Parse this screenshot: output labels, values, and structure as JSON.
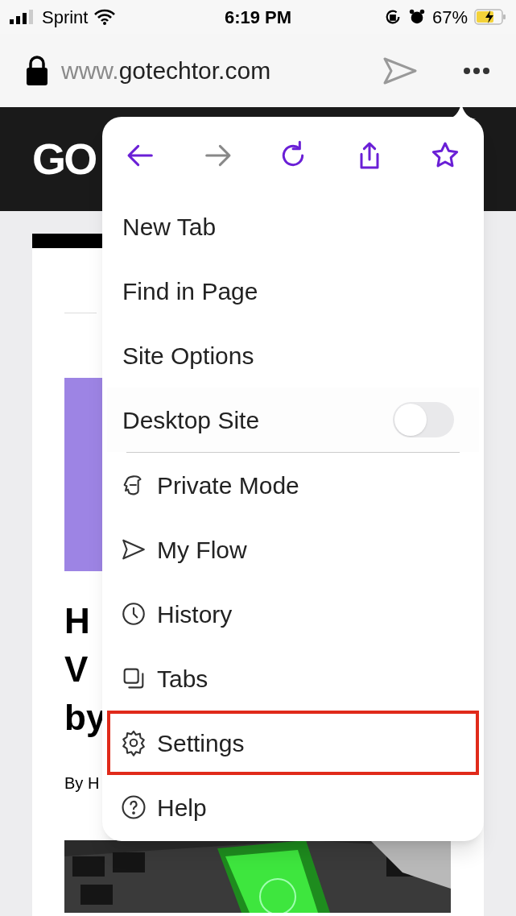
{
  "status_bar": {
    "carrier": "Sprint",
    "time": "6:19 PM",
    "battery": "67%",
    "charging": true
  },
  "address_bar": {
    "prefix": "www.",
    "domain": "gotechtor.com"
  },
  "page": {
    "logo": "GO",
    "headline": [
      "H",
      "V",
      "by"
    ],
    "byline": "By H"
  },
  "menu": {
    "toolbar": [
      {
        "kind": "back",
        "disabled": false
      },
      {
        "kind": "forward",
        "disabled": true
      },
      {
        "kind": "reload",
        "disabled": false
      },
      {
        "kind": "share",
        "disabled": false
      },
      {
        "kind": "bookmark",
        "disabled": false
      }
    ],
    "items": [
      {
        "kind": "plain",
        "label": "New Tab",
        "highlighted": false
      },
      {
        "kind": "plain",
        "label": "Find in Page",
        "highlighted": false
      },
      {
        "kind": "plain",
        "label": "Site Options",
        "highlighted": false
      },
      {
        "kind": "toggle",
        "label": "Desktop Site",
        "on": false,
        "highlighted": false
      },
      {
        "kind": "private",
        "label": "Private Mode",
        "highlighted": false
      },
      {
        "kind": "flow",
        "label": "My Flow",
        "highlighted": false
      },
      {
        "kind": "history",
        "label": "History",
        "highlighted": false
      },
      {
        "kind": "tabs",
        "label": "Tabs",
        "highlighted": false
      },
      {
        "kind": "settings",
        "label": "Settings",
        "highlighted": true
      },
      {
        "kind": "help",
        "label": "Help",
        "highlighted": false
      }
    ]
  }
}
